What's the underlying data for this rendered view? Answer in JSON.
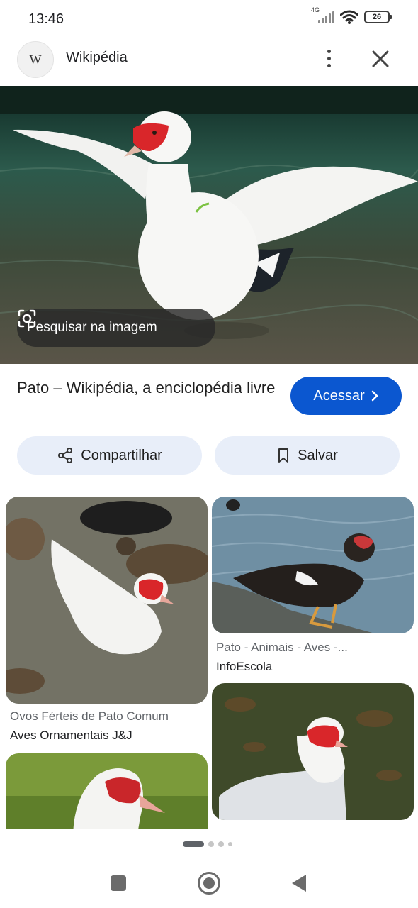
{
  "status_bar": {
    "time": "13:46",
    "network_label": "4G",
    "battery": "26",
    "icons": [
      "signal-icon",
      "wifi-icon",
      "battery-icon"
    ]
  },
  "header": {
    "site_logo": "W",
    "site_name": "Wikipédia",
    "icons": [
      "more-options-icon",
      "close-icon"
    ]
  },
  "hero": {
    "image": "White muscovy duck with red face spreading its wings in shallow water",
    "lens_label": "Pesquisar na imagem"
  },
  "result": {
    "title": "Pato – Wikipédia, a enciclopédia livre",
    "visit_label": "Acessar"
  },
  "actions": {
    "share_label": "Compartilhar",
    "save_label": "Salvar"
  },
  "related": [
    {
      "caption": "Ovos Férteis de Pato Comum",
      "source": "Aves Ornamentais J&J"
    },
    {
      "caption": "Pato - Animais - Aves -...",
      "source": "InfoEscola"
    },
    {
      "caption": "",
      "source": ""
    },
    {
      "caption": "",
      "source": ""
    }
  ],
  "colors": {
    "accent": "#0b57d0",
    "chip_background": "#e8eef9",
    "duck_face": "#d9262a"
  },
  "pagination": {
    "total": 4,
    "active": 1
  }
}
